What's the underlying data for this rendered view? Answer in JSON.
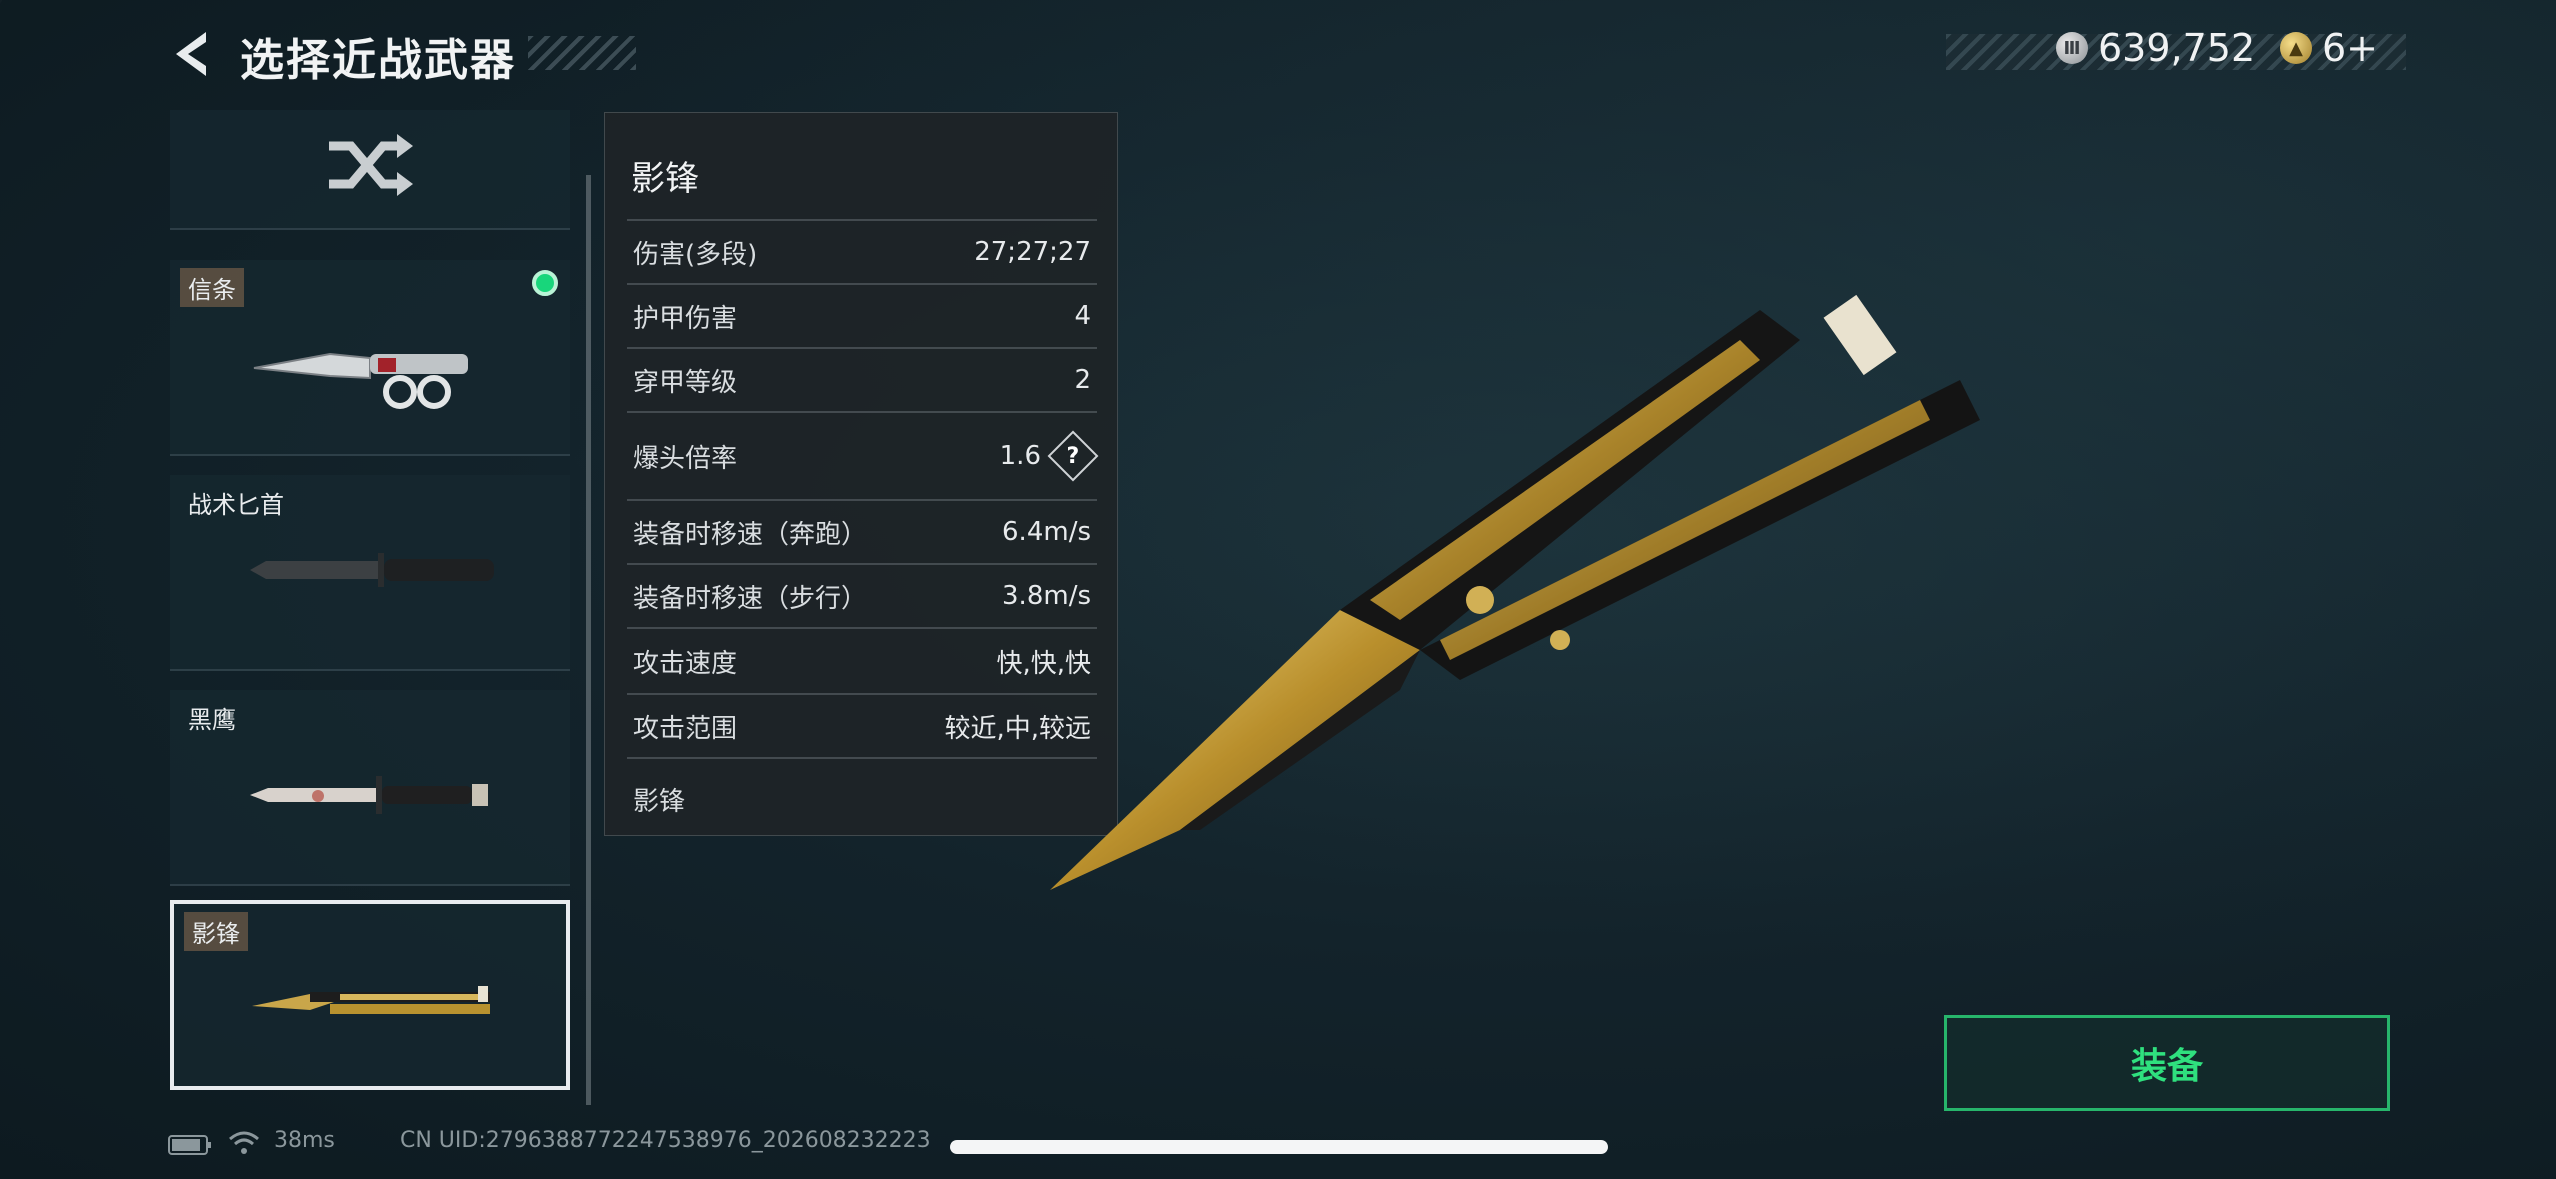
{
  "header": {
    "title": "选择近战武器",
    "currencies": [
      {
        "icon": "silver-coin-icon",
        "value": "639,752"
      },
      {
        "icon": "gold-coin-icon",
        "value": "6+"
      }
    ]
  },
  "weapon_list": {
    "random_icon": "shuffle-icon",
    "items": [
      {
        "label": "信条",
        "equipped": true,
        "selected": false
      },
      {
        "label": "战术匕首",
        "equipped": false,
        "selected": false
      },
      {
        "label": "黑鹰",
        "equipped": false,
        "selected": false
      },
      {
        "label": "影锋",
        "equipped": false,
        "selected": true
      }
    ]
  },
  "stats_panel": {
    "title": "影锋",
    "rows": [
      {
        "label": "伤害(多段)",
        "value": "27;27;27"
      },
      {
        "label": "护甲伤害",
        "value": "4"
      },
      {
        "label": "穿甲等级",
        "value": "2"
      },
      {
        "label": "爆头倍率",
        "value": "1.6"
      },
      {
        "label": "装备时移速（奔跑）",
        "value": "6.4m/s"
      },
      {
        "label": "装备时移速（步行）",
        "value": "3.8m/s"
      },
      {
        "label": "攻击速度",
        "value": "快,快,快"
      },
      {
        "label": "攻击范围",
        "value": "较近,中,较远"
      }
    ],
    "help_symbol": "?",
    "footer": "影锋"
  },
  "equip_button": {
    "label": "装备"
  },
  "status_bar": {
    "ping": "38ms",
    "uid": "CN UID:2796388772247538976_202608232223"
  },
  "colors": {
    "accent_green": "#2fe07e",
    "equipped_dot": "#18d67b"
  }
}
